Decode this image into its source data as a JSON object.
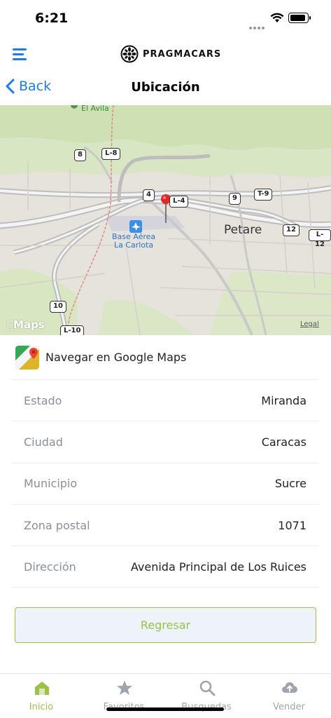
{
  "status_bar": {
    "time": "6:21"
  },
  "header": {
    "brand": "PRAGMACARS"
  },
  "nav": {
    "back_label": "Back",
    "title": "Ubicación"
  },
  "map": {
    "labels": {
      "el_avila": "El Ávila",
      "petare": "Petare",
      "airport_line1": "Base Aérea",
      "airport_line2": "La Carlota",
      "maps_logo": "Maps",
      "legal": "Legal"
    },
    "shields": [
      "8",
      "L-8",
      "4",
      "L-4",
      "9",
      "T-9",
      "12",
      "L-12",
      "10",
      "L-10"
    ]
  },
  "gmaps": {
    "label": "Navegar en Google Maps"
  },
  "details": [
    {
      "key": "Estado",
      "value": "Miranda"
    },
    {
      "key": "Ciudad",
      "value": "Caracas"
    },
    {
      "key": "Municipio",
      "value": "Sucre"
    },
    {
      "key": "Zona postal",
      "value": "1071"
    },
    {
      "key": "Dirección",
      "value": "Avenida Principal de Los Ruices"
    }
  ],
  "action": {
    "regresar_label": "Regresar"
  },
  "tabs": [
    {
      "label": "Inicio",
      "icon": "home-icon",
      "active": true
    },
    {
      "label": "Favoritos",
      "icon": "star-icon",
      "active": false
    },
    {
      "label": "Busquedas",
      "icon": "search-icon",
      "active": false
    },
    {
      "label": "Vender",
      "icon": "cloud-upload-icon",
      "active": false
    }
  ],
  "colors": {
    "accent_blue": "#1a7ce8",
    "accent_green": "#9cc04a"
  }
}
